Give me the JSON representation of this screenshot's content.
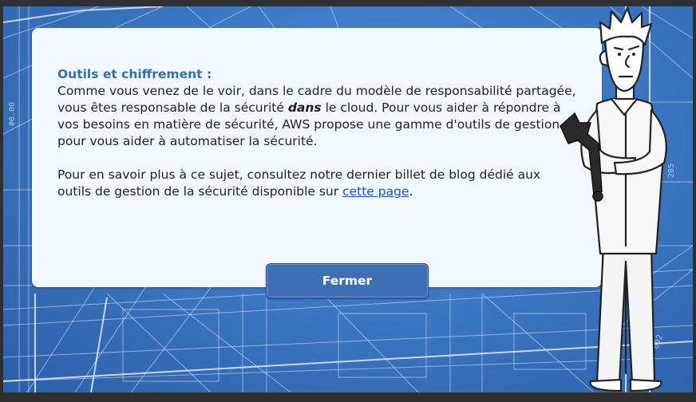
{
  "dialog": {
    "title": "Outils et chiffrement :",
    "paragraph1": {
      "before": "Comme vous venez de le voir, dans le cadre du modèle de responsabilité partagée, vous êtes responsable de la sécurité ",
      "emphasis": "dans",
      "after": " le cloud. Pour vous aider à répondre à vos besoins en matière de sécurité, AWS propose une gamme d'outils de gestion pour vous aider à automatiser la sécurité."
    },
    "paragraph2": {
      "before": "Pour en savoir plus à ce sujet, consultez notre dernier billet de blog dédié aux outils de gestion de la sécurité disponible sur ",
      "link_text": "cette page",
      "after": "."
    },
    "close_label": "Fermer"
  },
  "background": {
    "theme": "architectural blueprint",
    "label_1": "#0.00",
    "label_2": "285",
    "label_3": "002",
    "colors": {
      "base": "#3d78c4",
      "lines": "#dbe9fb"
    }
  },
  "character": {
    "description": "cartoon man with wrench",
    "icon": "wrench-icon"
  },
  "colors": {
    "title": "#2f6fb3",
    "button": "#3d6fb5",
    "link": "#1a4ed8",
    "panel": "#f3f8fc"
  }
}
